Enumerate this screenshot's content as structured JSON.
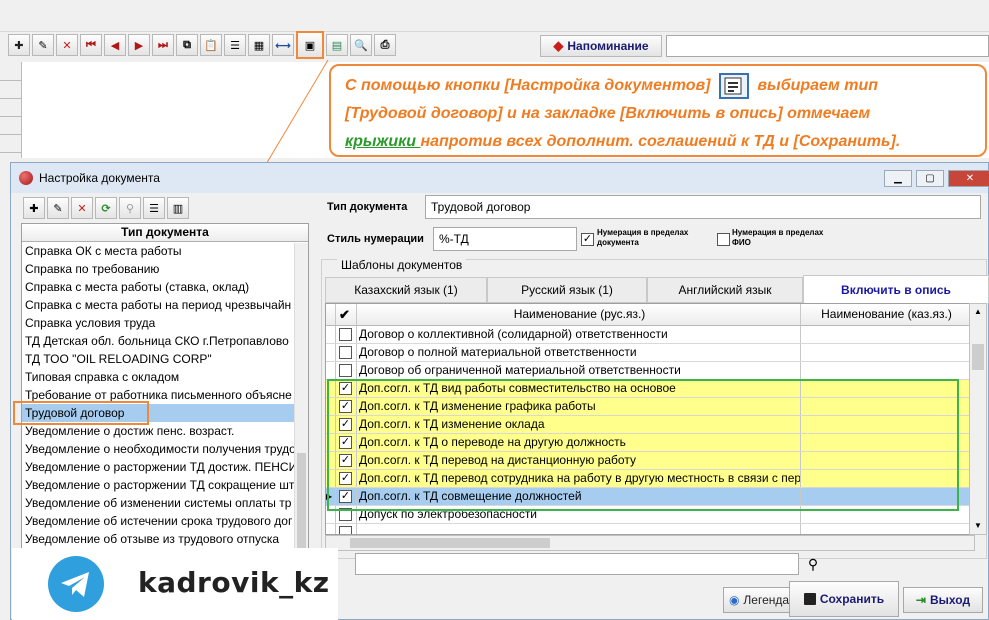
{
  "toolbar": {
    "icons": [
      "plus-icon",
      "edit-icon",
      "delete-icon",
      "first-icon",
      "prev-icon",
      "next-icon",
      "last-icon",
      "copy-icon",
      "paste-icon",
      "filter-icon",
      "calc-icon",
      "resize-icon",
      "doc-settings-icon",
      "data-icon",
      "preview-icon",
      "print-icon"
    ],
    "reminder_label": "Напоминание"
  },
  "callout": {
    "part1": "С помощью кнопки [Настройка документов]",
    "part2": "выбираем тип",
    "part3": "[Трудовой договор] и на закладке [Включить в опись] отмечаем",
    "part4_link": "крыжики ",
    "part5": "напротив всех дополнит. соглашений к ТД и [Сохранить]."
  },
  "dialog": {
    "title": "Настройка документа",
    "list_header": "Тип документа",
    "list_items": [
      "Справка ОК с места работы",
      "Справка по требованию",
      "Справка с места работы (ставка, оклад)",
      "Справка с места работы на период чрезвычайн",
      "Справка условия труда",
      "ТД Детская обл. больница СКО г.Петропавлово",
      "ТД ТОО \"OIL RELOADING CORP\"",
      "Типовая справка с окладом",
      "Требование от работника письменного объясне",
      "Трудовой договор",
      "Уведомление о достиж пенс. возраст.",
      "Уведомление о необходимости получения трудо",
      "Уведомление о расторжении ТД достиж. ПЕНСИ",
      "Уведомление о расторжении ТД сокращение шт",
      "Уведомление об изменении системы оплаты тр",
      "Уведомление об истечении срока трудового дог",
      "Уведомление об отзыве из трудового отпуска"
    ],
    "selected_index": 9,
    "doc_type_label": "Тип документа",
    "doc_type_value": "Трудовой договор",
    "numbering_style_label": "Стиль нумерации",
    "numbering_style_value": "%-ТД",
    "num_in_doc_label": "Нумерация в пределах документа",
    "num_in_doc_checked": true,
    "num_in_fio_label": "Нумерация в пределах ФИО",
    "num_in_fio_checked": false,
    "templates_label": "Шаблоны документов",
    "tabs": [
      "Казахский язык (1)",
      "Русский язык (1)",
      "Английский язык",
      "Включить в опись"
    ],
    "active_tab": 3,
    "grid_header_check": "✔",
    "grid_col1": "Наименование (рус.яз.)",
    "grid_col2": "Наименование (каз.яз.)",
    "grid_rows": [
      {
        "name": "Договор о коллективной (солидарной) ответственности",
        "checked": false,
        "style": "plain"
      },
      {
        "name": "Договор о полной материальной ответственности",
        "checked": false,
        "style": "plain"
      },
      {
        "name": "Договор об ограниченной материальной ответственности",
        "checked": false,
        "style": "plain"
      },
      {
        "name": "Доп.согл. к ТД вид работы совместительство на основое",
        "checked": true,
        "style": "yellow"
      },
      {
        "name": "Доп.согл. к ТД изменение графика работы",
        "checked": true,
        "style": "yellow"
      },
      {
        "name": "Доп.согл. к ТД изменение оклада",
        "checked": true,
        "style": "yellow"
      },
      {
        "name": "Доп.согл. к ТД о переводе на другую должность",
        "checked": true,
        "style": "yellow"
      },
      {
        "name": "Доп.согл. к ТД перевод на дистанционную работу",
        "checked": true,
        "style": "yellow"
      },
      {
        "name": "Доп.согл. к ТД перевод сотрудника на работу в другую местность в связи с пер",
        "checked": true,
        "style": "yellow"
      },
      {
        "name": "Доп.согл. к ТД совмещение должностей",
        "checked": true,
        "style": "blue"
      },
      {
        "name": "Допуск по электробезопасности",
        "checked": false,
        "style": "plain"
      },
      {
        "name": "",
        "checked": false,
        "style": "plain"
      }
    ],
    "legend_label": "Легенда",
    "save_label": "Сохранить",
    "exit_label": "Выход"
  },
  "watermark": {
    "handle": "kadrovik_kz"
  }
}
